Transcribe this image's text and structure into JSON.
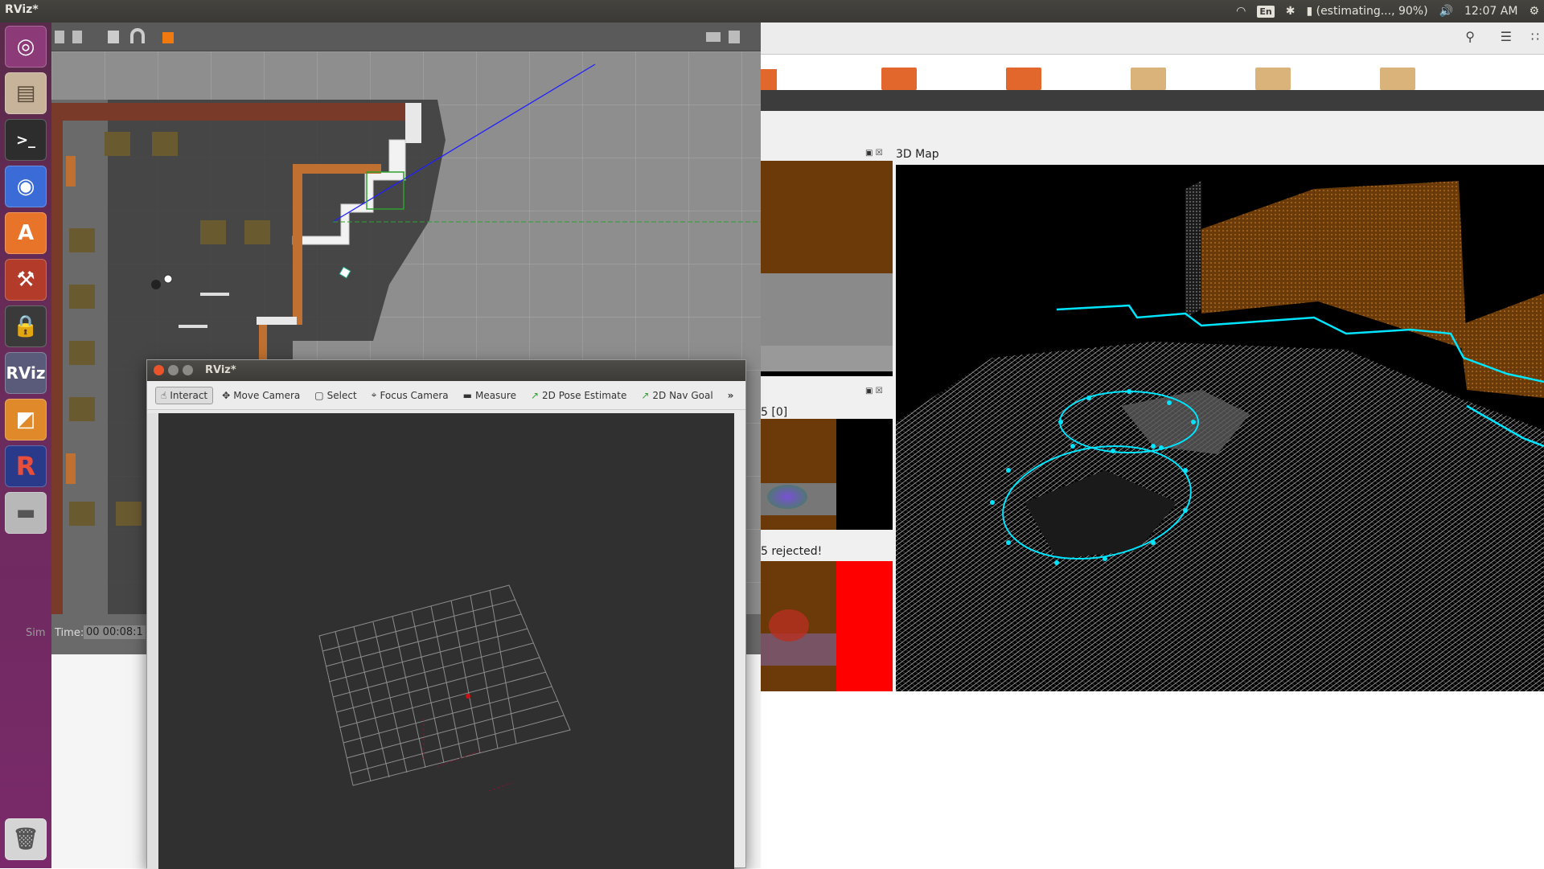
{
  "topbar": {
    "window_title": "RViz*",
    "keyboard": "En",
    "battery": "(estimating..., 90%)",
    "clock": "12:07 AM"
  },
  "launcher": {
    "items": [
      "ubuntu-dash",
      "files",
      "terminal",
      "chrome",
      "software-center",
      "system-settings",
      "screen-lock",
      "rviz",
      "gazebo",
      "rstudio",
      "disk"
    ],
    "trash": "trash",
    "labels": {
      "rviz": "RViz",
      "rstudio": "R"
    }
  },
  "gazebo": {
    "sim_label": "Sim",
    "time_label": "Time:",
    "time_value": "00 00:08:1"
  },
  "right_panel": {
    "map_title": "3D Map",
    "index_label": "5 [0]",
    "rejected_text": "5 rejected!"
  },
  "rviz": {
    "title": "RViz*",
    "tools": [
      {
        "label": "Interact",
        "icon": "hand-icon",
        "active": true
      },
      {
        "label": "Move Camera",
        "icon": "move-camera-icon"
      },
      {
        "label": "Select",
        "icon": "select-icon"
      },
      {
        "label": "Focus Camera",
        "icon": "focus-icon"
      },
      {
        "label": "Measure",
        "icon": "ruler-icon"
      },
      {
        "label": "2D Pose Estimate",
        "icon": "pose-arrow-icon"
      },
      {
        "label": "2D Nav Goal",
        "icon": "nav-arrow-icon"
      }
    ],
    "more": "»"
  },
  "colors": {
    "launcher": "#6b2b5c",
    "map_bg": "#000000",
    "rviz_bg": "#303030",
    "trajectory": "#00e5ff",
    "wall": "#8a4a10"
  }
}
